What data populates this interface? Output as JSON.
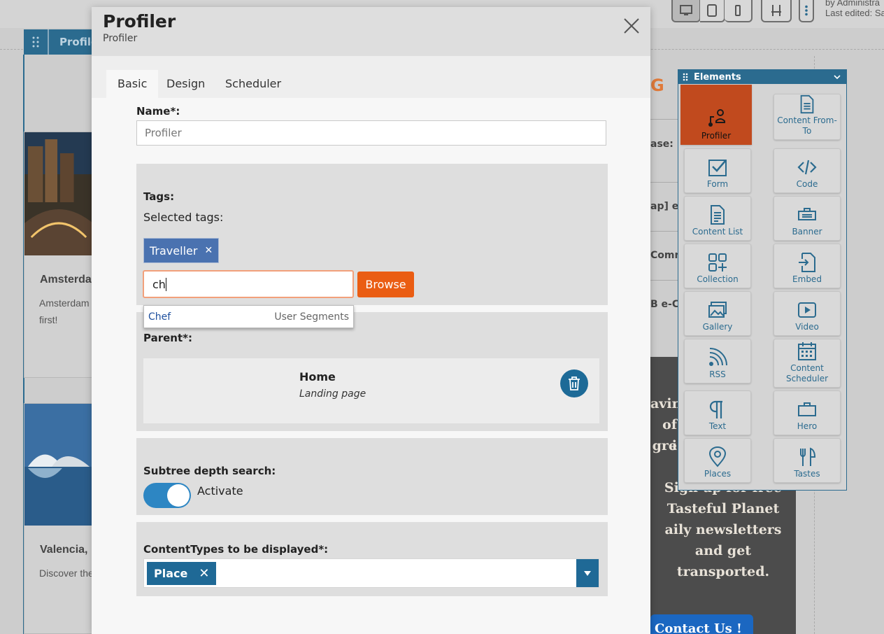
{
  "background": {
    "block_label": "Profile",
    "meta_lines": [
      "by Administra",
      "Last edited: Sa"
    ],
    "cards": [
      {
        "title": "Amsterdam",
        "text_lines": [
          "Amsterdam",
          "first!"
        ]
      },
      {
        "title": "Valencia,",
        "text_lines": [
          "Discover the"
        ]
      }
    ],
    "logo_fragment": "G",
    "right_fragments": [
      "ase: Di",
      "ap] eZ",
      "Comm",
      "B e-Co"
    ],
    "panel_lines": [
      "aving",
      "of gre",
      "i",
      "Sign up for free",
      "Tasteful Planet",
      "aily newsletters",
      "and get",
      "transported."
    ],
    "contact_label": "Contact Us !"
  },
  "palette": {
    "title": "Elements",
    "items": [
      {
        "label": "Profiler",
        "icon": "profiler-icon"
      },
      {
        "label": "Content From-To",
        "icon": "content-from-to-icon"
      },
      {
        "label": "Form",
        "icon": "form-icon"
      },
      {
        "label": "Code",
        "icon": "code-icon"
      },
      {
        "label": "Content List",
        "icon": "content-list-icon"
      },
      {
        "label": "Banner",
        "icon": "banner-icon"
      },
      {
        "label": "Collection",
        "icon": "collection-icon"
      },
      {
        "label": "Embed",
        "icon": "embed-icon"
      },
      {
        "label": "Gallery",
        "icon": "gallery-icon"
      },
      {
        "label": "Video",
        "icon": "video-icon"
      },
      {
        "label": "RSS",
        "icon": "rss-icon"
      },
      {
        "label": "Content Scheduler",
        "icon": "content-scheduler-icon"
      },
      {
        "label": "Text",
        "icon": "text-icon"
      },
      {
        "label": "Hero",
        "icon": "hero-icon"
      },
      {
        "label": "Places",
        "icon": "places-icon"
      },
      {
        "label": "Tastes",
        "icon": "tastes-icon"
      }
    ]
  },
  "modal": {
    "title": "Profiler",
    "subtitle": "Profiler",
    "tabs": [
      {
        "label": "Basic",
        "active": true
      },
      {
        "label": "Design",
        "active": false
      },
      {
        "label": "Scheduler",
        "active": false
      }
    ],
    "name_label": "Name*:",
    "name_value": "Profiler",
    "tags_label": "Tags:",
    "selected_tags_label": "Selected tags:",
    "selected_tags": [
      "Traveller"
    ],
    "tag_input_value": "ch",
    "browse_label": "Browse",
    "suggestion": {
      "name": "Chef",
      "group": "User Segments"
    },
    "parent_label": "Parent*:",
    "parent_name": "Home",
    "parent_type": "Landing page",
    "subtree_label": "Subtree depth search:",
    "subtree_toggle_label": "Activate",
    "subtree_active": true,
    "contenttypes_label": "ContentTypes to be displayed*:",
    "contenttypes_selected": [
      "Place"
    ]
  },
  "colors": {
    "accent": "#1f6996",
    "browse": "#ea5d13",
    "active_element": "#c14a1e",
    "tag_chip": "#4a72b0"
  }
}
